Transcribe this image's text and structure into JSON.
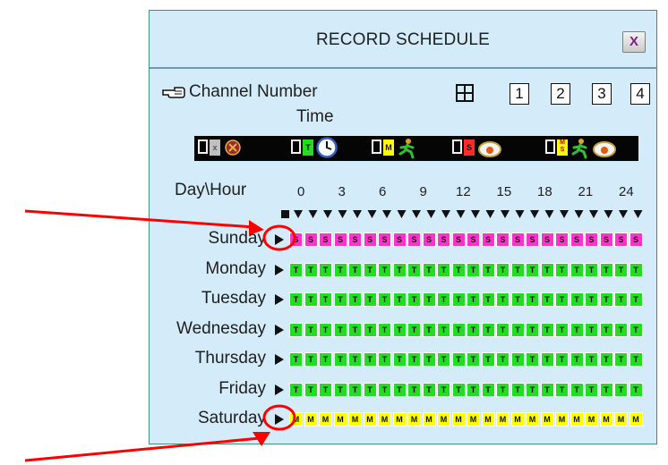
{
  "dialog": {
    "title": "RECORD SCHEDULE",
    "close_label": "X",
    "channel_label": "Channel Number",
    "time_label": "Time",
    "channel_buttons": [
      "1",
      "2",
      "3",
      "4"
    ]
  },
  "legend": [
    {
      "letter": "x",
      "color": "#c0c0c0",
      "icon": "no-record-icon"
    },
    {
      "letter": "T",
      "color": "#22dd22",
      "icon": "clock-icon"
    },
    {
      "letter": "M",
      "color": "#ffff00",
      "icon": "motion-person-icon"
    },
    {
      "letter": "S",
      "color": "#ff2a2a",
      "icon": "sensor-camera-icon"
    },
    {
      "letter": "M/S",
      "color": "#ffff00",
      "icon": "motion-sensor-icon"
    }
  ],
  "schedule": {
    "header": "Day\\Hour",
    "hour_ticks": [
      "0",
      "3",
      "6",
      "9",
      "12",
      "15",
      "18",
      "21",
      "24"
    ],
    "days": [
      {
        "name": "Sunday",
        "mode": "S",
        "color": "#ff33cc"
      },
      {
        "name": "Monday",
        "mode": "T",
        "color": "#22dd22"
      },
      {
        "name": "Tuesday",
        "mode": "T",
        "color": "#22dd22"
      },
      {
        "name": "Wednesday",
        "mode": "T",
        "color": "#22dd22"
      },
      {
        "name": "Thursday",
        "mode": "T",
        "color": "#22dd22"
      },
      {
        "name": "Friday",
        "mode": "T",
        "color": "#22dd22"
      },
      {
        "name": "Saturday",
        "mode": "M",
        "color": "#ffff00"
      }
    ],
    "slots_per_day": 24
  },
  "annotations": {
    "color": "#ff0000"
  }
}
